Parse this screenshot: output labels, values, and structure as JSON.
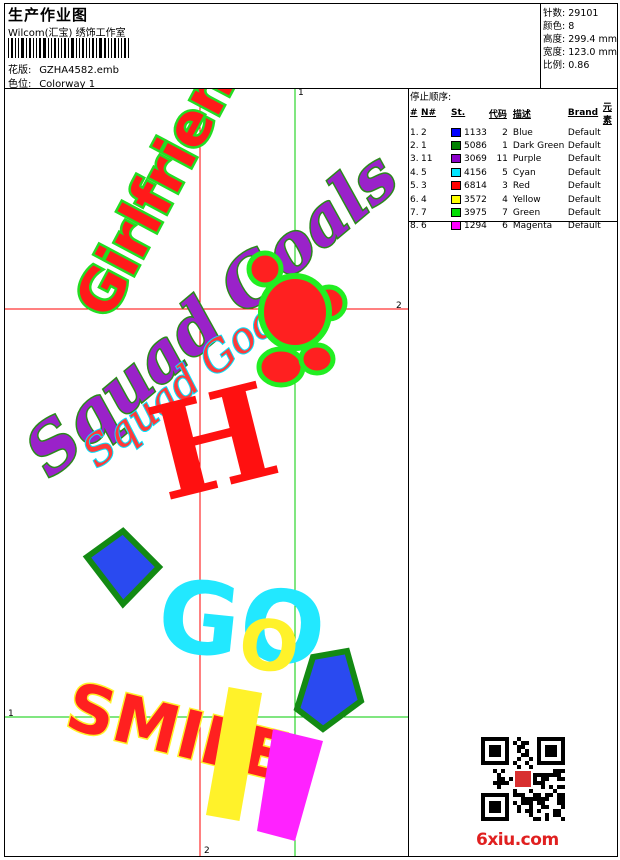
{
  "header": {
    "title": "生产作业图",
    "company": "Wilcom(汇宝) 绣饰工作室",
    "design_label": "花版:",
    "design_value": "GZHA4582.emb",
    "colorway_label": "色位:",
    "colorway_value": "Colorway 1"
  },
  "specs": [
    {
      "label": "针数:",
      "value": "29101"
    },
    {
      "label": "颜色:",
      "value": "8"
    },
    {
      "label": "高度:",
      "value": "299.4 mm"
    },
    {
      "label": "宽度:",
      "value": "123.0 mm"
    },
    {
      "label": "比例:",
      "value": "0.86"
    }
  ],
  "stop_sequence": {
    "title": "停止顺序:",
    "columns": [
      "#",
      "N#",
      "St.",
      "代码",
      "描述",
      "Brand",
      "元素"
    ],
    "rows": [
      {
        "idx": "1.",
        "n": "2",
        "color": "#0000ff",
        "st": "1133",
        "code": "2",
        "desc": "Blue",
        "brand": "Default"
      },
      {
        "idx": "2.",
        "n": "1",
        "color": "#008000",
        "st": "5086",
        "code": "1",
        "desc": "Dark Green",
        "brand": "Default"
      },
      {
        "idx": "3.",
        "n": "11",
        "color": "#8b00c9",
        "st": "3069",
        "code": "11",
        "desc": "Purple",
        "brand": "Default"
      },
      {
        "idx": "4.",
        "n": "5",
        "color": "#00e5ff",
        "st": "4156",
        "code": "5",
        "desc": "Cyan",
        "brand": "Default"
      },
      {
        "idx": "5.",
        "n": "3",
        "color": "#ff0000",
        "st": "6814",
        "code": "3",
        "desc": "Red",
        "brand": "Default"
      },
      {
        "idx": "6.",
        "n": "4",
        "color": "#ffff00",
        "st": "3572",
        "code": "4",
        "desc": "Yellow",
        "brand": "Default"
      },
      {
        "idx": "7.",
        "n": "7",
        "color": "#00dd00",
        "st": "3975",
        "code": "7",
        "desc": "Green",
        "brand": "Default"
      },
      {
        "idx": "8.",
        "n": "6",
        "color": "#ff00ff",
        "st": "1294",
        "code": "6",
        "desc": "Magenta",
        "brand": "Default"
      }
    ]
  },
  "axes": {
    "top_v": "1",
    "right_h": "2",
    "bottom_v": "2",
    "left_h": "1"
  },
  "design_text": {
    "word1": "Girlfriend",
    "word2": "Squad Goals",
    "word3": "H",
    "word4": "GO",
    "word5": "SMILE"
  },
  "watermark": {
    "logo": "6xiu.com"
  }
}
